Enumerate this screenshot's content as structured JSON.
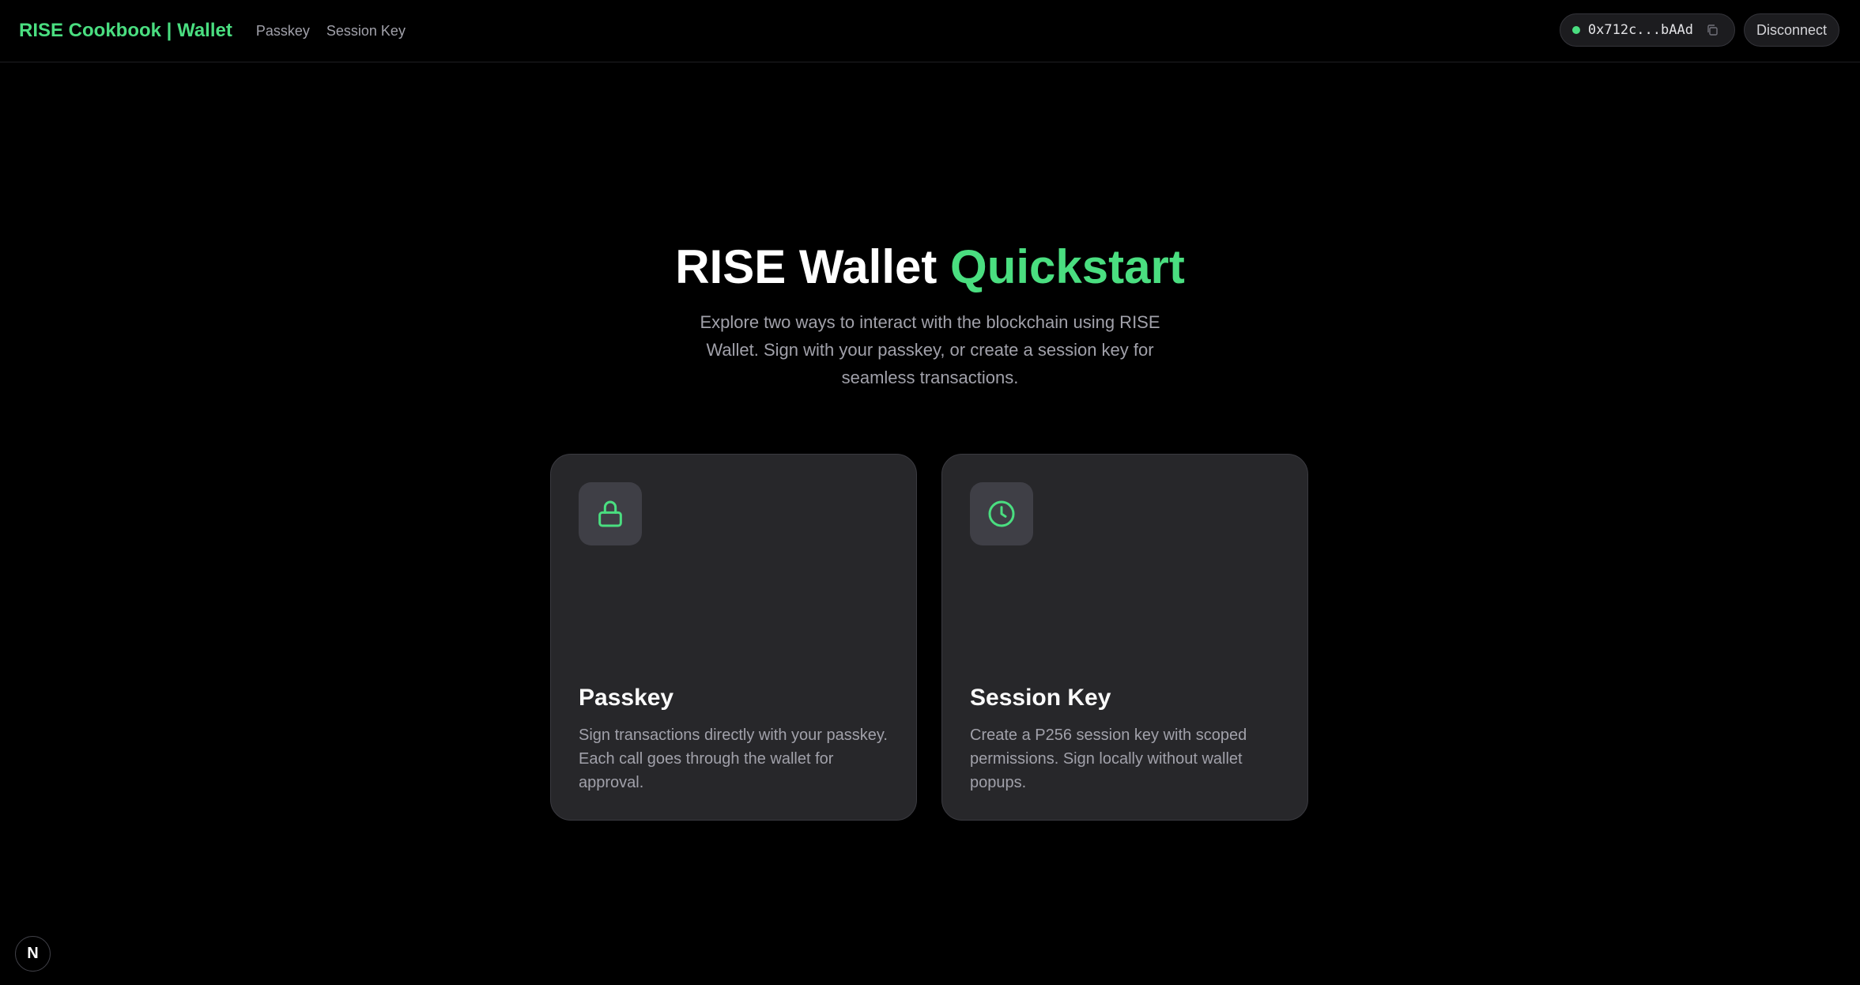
{
  "nav": {
    "brand": "RISE Cookbook | Wallet",
    "links": [
      "Passkey",
      "Session Key"
    ],
    "address": "0x712c...bAAd",
    "disconnect_label": "Disconnect"
  },
  "hero": {
    "title_main": "RISE Wallet",
    "title_accent": "Quickstart",
    "subtitle": "Explore two ways to interact with the blockchain using RISE Wallet. Sign with your passkey, or create a session key for seamless transactions."
  },
  "cards": [
    {
      "icon": "lock-icon",
      "title": "Passkey",
      "description": "Sign transactions directly with your passkey. Each call goes through the wallet for approval."
    },
    {
      "icon": "clock-icon",
      "title": "Session Key",
      "description": "Create a P256 session key with scoped permissions. Sign locally without wallet popups."
    }
  ],
  "devtools_badge": "N",
  "colors": {
    "accent": "#4ade80",
    "background": "#000000",
    "card": "#27272a"
  }
}
